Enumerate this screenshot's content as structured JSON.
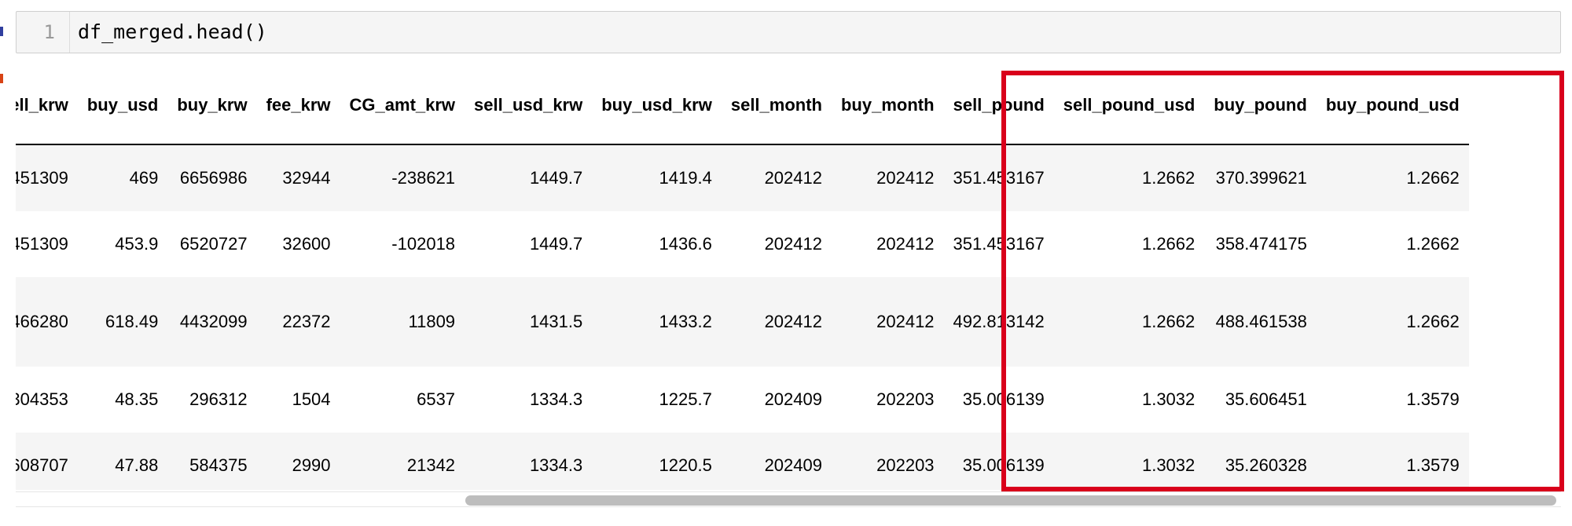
{
  "cell": {
    "line_number": "1",
    "code": "df_merged.head()"
  },
  "table": {
    "columns": [
      "sell_krw",
      "buy_usd",
      "buy_krw",
      "fee_krw",
      "CG_amt_krw",
      "sell_usd_krw",
      "buy_usd_krw",
      "sell_month",
      "buy_month",
      "sell_pound",
      "sell_pound_usd",
      "buy_pound",
      "buy_pound_usd"
    ],
    "rows": [
      [
        "451309",
        "469",
        "6656986",
        "32944",
        "-238621",
        "1449.7",
        "1419.4",
        "202412",
        "202412",
        "351.453167",
        "1.2662",
        "370.399621",
        "1.2662"
      ],
      [
        "451309",
        "453.9",
        "6520727",
        "32600",
        "-102018",
        "1449.7",
        "1436.6",
        "202412",
        "202412",
        "351.453167",
        "1.2662",
        "358.474175",
        "1.2662"
      ],
      [
        "466280",
        "618.49",
        "4432099",
        "22372",
        "11809",
        "1431.5",
        "1433.2",
        "202412",
        "202412",
        "492.813142",
        "1.2662",
        "488.461538",
        "1.2662"
      ],
      [
        "304353",
        "48.35",
        "296312",
        "1504",
        "6537",
        "1334.3",
        "1225.7",
        "202409",
        "202203",
        "35.006139",
        "1.3032",
        "35.606451",
        "1.3579"
      ],
      [
        "608707",
        "47.88",
        "584375",
        "2990",
        "21342",
        "1334.3",
        "1220.5",
        "202409",
        "202203",
        "35.006139",
        "1.3032",
        "35.260328",
        "1.3579"
      ]
    ]
  },
  "highlight": {
    "columns": [
      "sell_pound",
      "sell_pound_usd",
      "buy_pound",
      "buy_pound_usd"
    ],
    "color": "#d9001b"
  },
  "colors": {
    "input_marker": "#303f9f",
    "output_marker": "#d84315",
    "scroll_thumb": "#bdbdbd"
  }
}
